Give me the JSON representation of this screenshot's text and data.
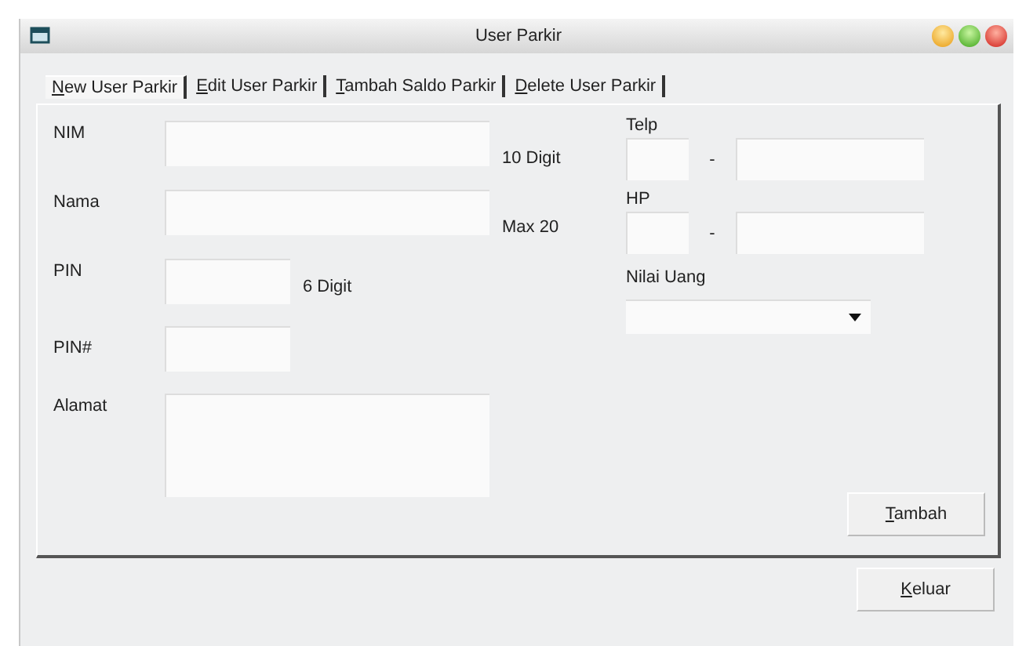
{
  "window": {
    "title": "User Parkir"
  },
  "tabs": [
    {
      "key": "N",
      "rest": "ew User Parkir",
      "selected": true
    },
    {
      "key": "E",
      "rest": "dit User Parkir",
      "selected": false
    },
    {
      "key": "T",
      "rest": "ambah Saldo Parkir",
      "selected": false
    },
    {
      "key": "D",
      "rest": "elete User Parkir",
      "selected": false
    }
  ],
  "form": {
    "nim": {
      "label": "NIM",
      "note": "10 Digit"
    },
    "nama": {
      "label": "Nama",
      "note": "Max 20"
    },
    "pin": {
      "label": "PIN",
      "note": "6 Digit"
    },
    "pin2": {
      "label": "PIN#"
    },
    "alamat": {
      "label": "Alamat"
    },
    "telp": {
      "label": "Telp",
      "separator": "-"
    },
    "hp": {
      "label": "HP",
      "separator": "-"
    },
    "nilai_uang": {
      "label": "Nilai Uang"
    }
  },
  "add_button": {
    "key": "T",
    "rest": "ambah"
  },
  "exit_button": {
    "key": "K",
    "rest": "eluar"
  }
}
